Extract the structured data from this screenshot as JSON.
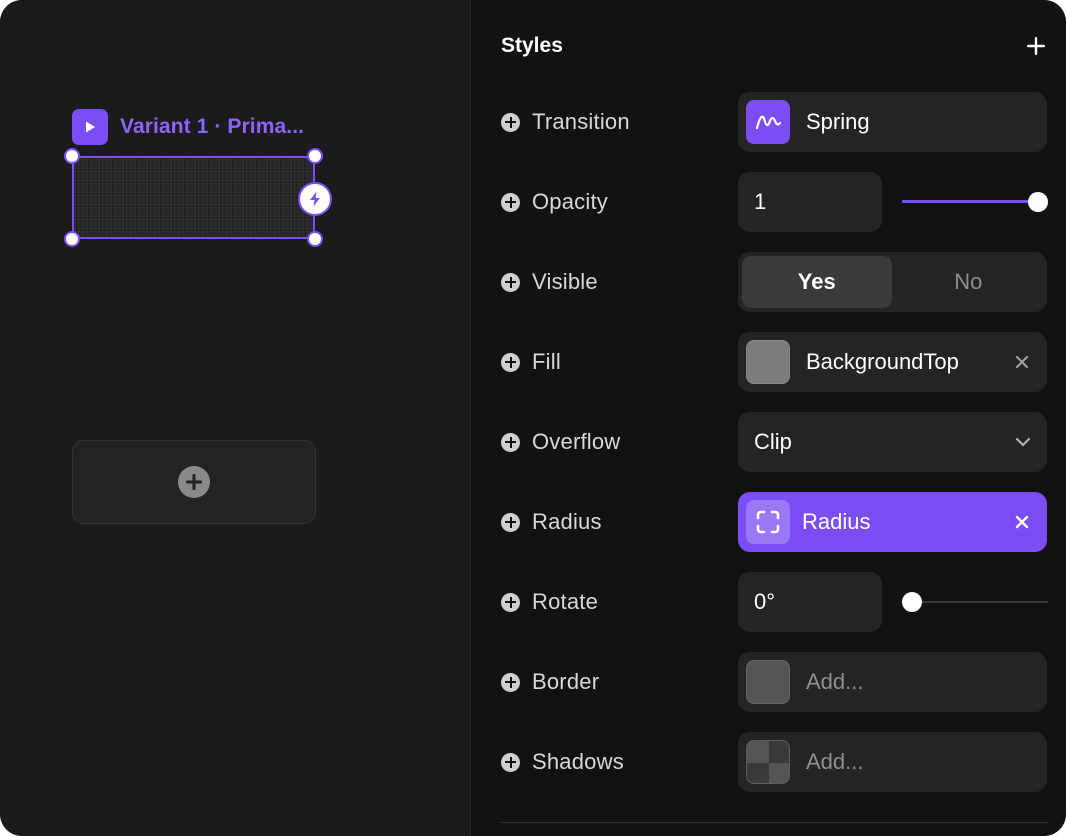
{
  "canvas": {
    "variant_label": "Variant 1 · Prima..."
  },
  "panel": {
    "title": "Styles",
    "rows": {
      "transition": {
        "label": "Transition",
        "value": "Spring"
      },
      "opacity": {
        "label": "Opacity",
        "value": "1",
        "slider_fraction": 1.0
      },
      "visible": {
        "label": "Visible",
        "option_yes": "Yes",
        "option_no": "No",
        "selected": "Yes"
      },
      "fill": {
        "label": "Fill",
        "value": "BackgroundTop",
        "swatch_color": "#7c7c7c"
      },
      "overflow": {
        "label": "Overflow",
        "value": "Clip"
      },
      "radius": {
        "label": "Radius",
        "value": "Radius"
      },
      "rotate": {
        "label": "Rotate",
        "value": "0°",
        "slider_fraction": 0.0
      },
      "border": {
        "label": "Border",
        "placeholder": "Add..."
      },
      "shadows": {
        "label": "Shadows",
        "placeholder": "Add..."
      }
    }
  },
  "colors": {
    "accent": "#7b4ef5",
    "panel_bg": "#121212",
    "canvas_bg": "#1b1b1b",
    "control_bg": "#242424"
  },
  "icons": {
    "play": "play-icon",
    "bolt": "lightning-bolt-icon",
    "add": "plus-icon",
    "spring": "spring-curve-icon",
    "chevron": "chevron-down-icon",
    "close": "close-icon",
    "radius": "radius-corners-icon"
  }
}
